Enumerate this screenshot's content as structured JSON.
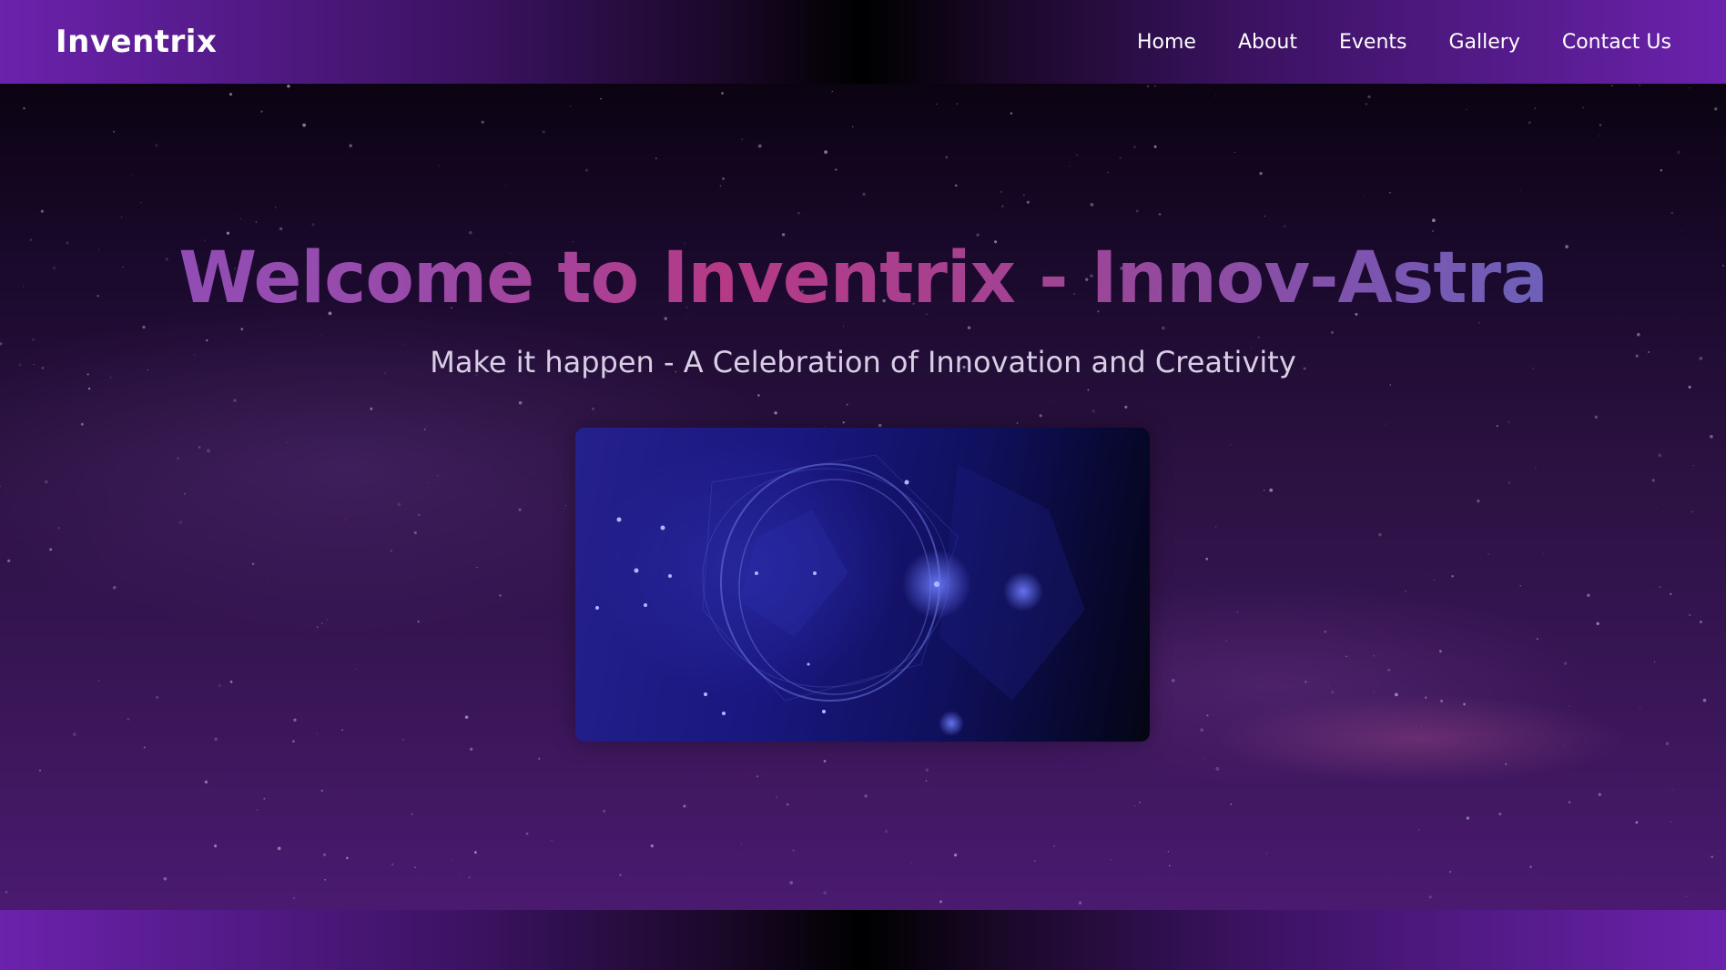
{
  "navbar": {
    "brand": "Inventrix",
    "links": [
      {
        "label": "Home"
      },
      {
        "label": "About"
      },
      {
        "label": "Events"
      },
      {
        "label": "Gallery"
      },
      {
        "label": "Contact Us"
      }
    ]
  },
  "hero": {
    "title": "Welcome to Inventrix - Innov-Astra",
    "subtitle": "Make it happen - A Celebration of Innovation and Creativity",
    "image": {
      "description_icon": "abstract-network-sphere-image"
    }
  },
  "colors": {
    "nav_edge": "#6b22ad",
    "nav_center": "#000000",
    "hero_bg_top": "#0b0312",
    "hero_bg_bottom": "#4a1a70",
    "title_gradient_start": "#8a4fbd",
    "title_gradient_mid": "#b53a86",
    "title_gradient_end": "#5d6ec2",
    "subtitle": "#d8cfe6"
  }
}
